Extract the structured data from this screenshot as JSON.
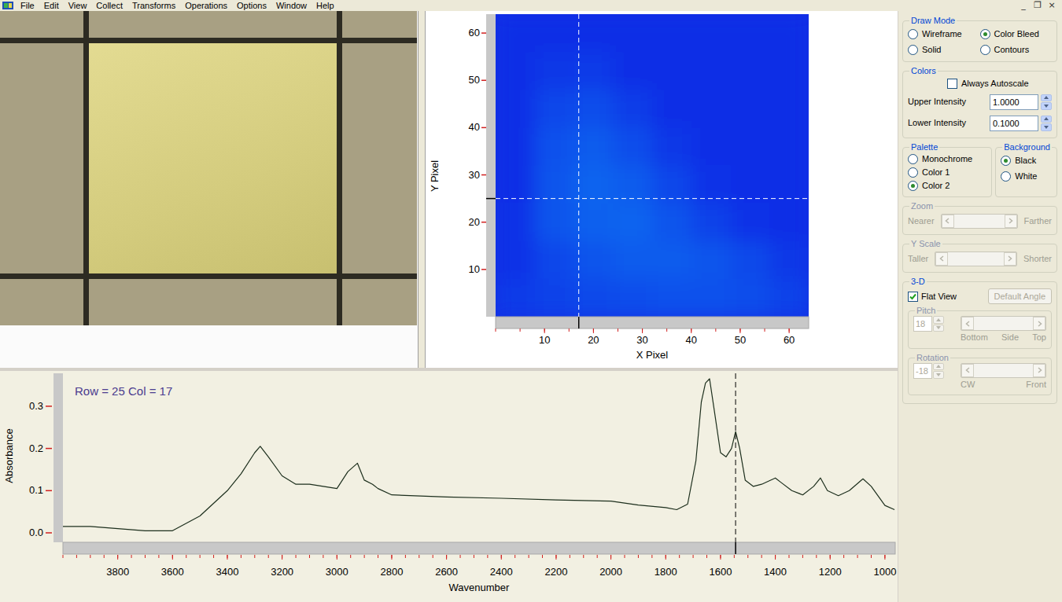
{
  "window": {
    "controls": [
      "_",
      "❐",
      "×"
    ]
  },
  "menu": [
    "File",
    "Edit",
    "View",
    "Collect",
    "Transforms",
    "Operations",
    "Options",
    "Window",
    "Help"
  ],
  "map": {
    "y_label": "Y Pixel",
    "x_label": "X Pixel",
    "y_ticks": [
      "10",
      "20",
      "30",
      "40",
      "50",
      "60"
    ],
    "x_ticks": [
      "10",
      "20",
      "30",
      "40",
      "50",
      "60"
    ],
    "crosshair": {
      "x": 17,
      "y": 25
    },
    "intensity": [
      [
        0.1,
        0.1,
        0.1,
        0.1,
        0.1,
        0.1,
        0.1,
        0.1
      ],
      [
        0.1,
        0.12,
        0.13,
        0.1,
        0.1,
        0.1,
        0.1,
        0.1
      ],
      [
        0.1,
        0.16,
        0.18,
        0.14,
        0.1,
        0.1,
        0.1,
        0.1
      ],
      [
        0.1,
        0.19,
        0.22,
        0.18,
        0.12,
        0.1,
        0.1,
        0.1
      ],
      [
        0.1,
        0.2,
        0.24,
        0.22,
        0.16,
        0.11,
        0.1,
        0.1
      ],
      [
        0.11,
        0.2,
        0.23,
        0.24,
        0.2,
        0.15,
        0.11,
        0.1
      ],
      [
        0.11,
        0.16,
        0.2,
        0.22,
        0.22,
        0.2,
        0.17,
        0.12
      ],
      [
        0.13,
        0.15,
        0.17,
        0.18,
        0.19,
        0.19,
        0.18,
        0.15
      ]
    ]
  },
  "spectrum": {
    "caption": "Row = 25 Col = 17",
    "y_label": "Absorbance",
    "x_label": "Wavenumber",
    "y_ticks": [
      "0.0",
      "0.1",
      "0.2",
      "0.3"
    ],
    "x_ticks": [
      "3800",
      "3600",
      "3400",
      "3200",
      "3000",
      "2800",
      "2600",
      "2400",
      "2200",
      "2000",
      "1800",
      "1600",
      "1400",
      "1200",
      "1000"
    ],
    "wavenumber": [
      4000,
      3900,
      3800,
      3700,
      3600,
      3500,
      3400,
      3350,
      3300,
      3280,
      3250,
      3200,
      3150,
      3100,
      3050,
      3000,
      2960,
      2925,
      2900,
      2870,
      2850,
      2800,
      2600,
      2400,
      2200,
      2000,
      1900,
      1800,
      1760,
      1720,
      1690,
      1670,
      1655,
      1640,
      1625,
      1600,
      1580,
      1560,
      1545,
      1530,
      1510,
      1480,
      1450,
      1400,
      1380,
      1340,
      1300,
      1260,
      1235,
      1210,
      1170,
      1130,
      1080,
      1050,
      1000,
      965
    ],
    "absorbance": [
      0.015,
      0.015,
      0.01,
      0.005,
      0.005,
      0.04,
      0.1,
      0.14,
      0.19,
      0.205,
      0.18,
      0.135,
      0.115,
      0.115,
      0.11,
      0.105,
      0.145,
      0.165,
      0.125,
      0.115,
      0.105,
      0.09,
      0.085,
      0.082,
      0.078,
      0.075,
      0.066,
      0.06,
      0.055,
      0.068,
      0.17,
      0.31,
      0.355,
      0.365,
      0.3,
      0.19,
      0.18,
      0.2,
      0.24,
      0.2,
      0.125,
      0.11,
      0.115,
      0.13,
      0.12,
      0.1,
      0.09,
      0.11,
      0.13,
      0.1,
      0.088,
      0.1,
      0.128,
      0.11,
      0.065,
      0.055
    ],
    "marker": 1545
  },
  "controls": {
    "draw_mode": {
      "title": "Draw Mode",
      "options": [
        {
          "label": "Wireframe",
          "selected": false
        },
        {
          "label": "Color Bleed",
          "selected": true
        },
        {
          "label": "Solid",
          "selected": false
        },
        {
          "label": "Contours",
          "selected": false
        }
      ]
    },
    "colors": {
      "title": "Colors",
      "autoscale": {
        "label": "Always Autoscale",
        "checked": false
      },
      "fields": [
        {
          "label": "Upper Intensity",
          "value": "1.0000"
        },
        {
          "label": "Lower Intensity",
          "value": "0.1000"
        }
      ]
    },
    "palette": {
      "title": "Palette",
      "options": [
        {
          "label": "Monochrome",
          "selected": false
        },
        {
          "label": "Color 1",
          "selected": false
        },
        {
          "label": "Color 2",
          "selected": true
        }
      ]
    },
    "background": {
      "title": "Background",
      "options": [
        {
          "label": "Black",
          "selected": true
        },
        {
          "label": "White",
          "selected": false
        }
      ]
    },
    "zoom": {
      "title": "Zoom",
      "left": "Nearer",
      "right": "Farther",
      "disabled": true
    },
    "y_scale": {
      "title": "Y Scale",
      "left": "Taller",
      "right": "Shorter",
      "disabled": true
    },
    "three_d": {
      "title": "3-D",
      "flat_view": {
        "label": "Flat View",
        "checked": true
      },
      "default_angle": {
        "label": "Default Angle",
        "disabled": true
      },
      "pitch": {
        "title": "Pitch",
        "value": "18",
        "labels": [
          "Bottom",
          "Side",
          "Top"
        ],
        "disabled": true
      },
      "rotation": {
        "title": "Rotation",
        "value": "-18",
        "labels": [
          "CW",
          "Front"
        ],
        "disabled": true
      }
    }
  }
}
